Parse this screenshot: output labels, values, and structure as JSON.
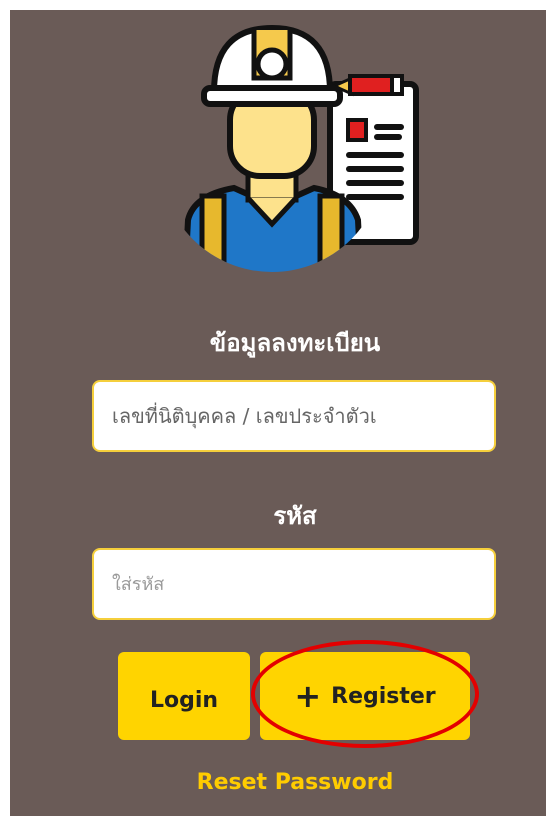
{
  "form": {
    "registration_label": "ข้อมูลลงทะเบียน",
    "registration_placeholder": "เลขที่นิติบุคคล / เลขประจำตัวเ",
    "password_label": "รหัส",
    "password_placeholder": "ใส่รหัส",
    "login_label": "Login",
    "register_plus": "+",
    "register_label": "Register",
    "reset_label": "Reset Password"
  },
  "colors": {
    "panel_bg": "#6a5b57",
    "button_yellow": "#ffd400",
    "link_yellow": "#ffcc00",
    "highlight_red": "#e30000"
  },
  "icons": [
    "engineer-avatar-icon"
  ]
}
